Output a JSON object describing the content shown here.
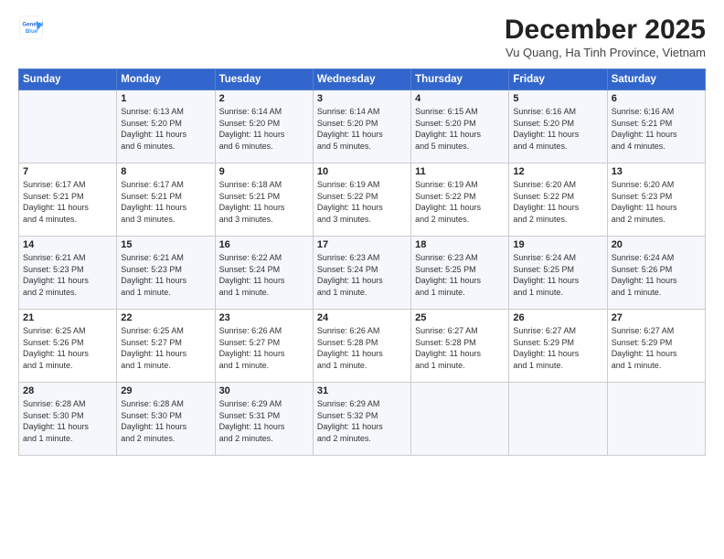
{
  "header": {
    "logo_line1": "General",
    "logo_line2": "Blue",
    "title": "December 2025",
    "subtitle": "Vu Quang, Ha Tinh Province, Vietnam"
  },
  "days_of_week": [
    "Sunday",
    "Monday",
    "Tuesday",
    "Wednesday",
    "Thursday",
    "Friday",
    "Saturday"
  ],
  "weeks": [
    [
      {
        "num": "",
        "info": ""
      },
      {
        "num": "1",
        "info": "Sunrise: 6:13 AM\nSunset: 5:20 PM\nDaylight: 11 hours\nand 6 minutes."
      },
      {
        "num": "2",
        "info": "Sunrise: 6:14 AM\nSunset: 5:20 PM\nDaylight: 11 hours\nand 6 minutes."
      },
      {
        "num": "3",
        "info": "Sunrise: 6:14 AM\nSunset: 5:20 PM\nDaylight: 11 hours\nand 5 minutes."
      },
      {
        "num": "4",
        "info": "Sunrise: 6:15 AM\nSunset: 5:20 PM\nDaylight: 11 hours\nand 5 minutes."
      },
      {
        "num": "5",
        "info": "Sunrise: 6:16 AM\nSunset: 5:20 PM\nDaylight: 11 hours\nand 4 minutes."
      },
      {
        "num": "6",
        "info": "Sunrise: 6:16 AM\nSunset: 5:21 PM\nDaylight: 11 hours\nand 4 minutes."
      }
    ],
    [
      {
        "num": "7",
        "info": "Sunrise: 6:17 AM\nSunset: 5:21 PM\nDaylight: 11 hours\nand 4 minutes."
      },
      {
        "num": "8",
        "info": "Sunrise: 6:17 AM\nSunset: 5:21 PM\nDaylight: 11 hours\nand 3 minutes."
      },
      {
        "num": "9",
        "info": "Sunrise: 6:18 AM\nSunset: 5:21 PM\nDaylight: 11 hours\nand 3 minutes."
      },
      {
        "num": "10",
        "info": "Sunrise: 6:19 AM\nSunset: 5:22 PM\nDaylight: 11 hours\nand 3 minutes."
      },
      {
        "num": "11",
        "info": "Sunrise: 6:19 AM\nSunset: 5:22 PM\nDaylight: 11 hours\nand 2 minutes."
      },
      {
        "num": "12",
        "info": "Sunrise: 6:20 AM\nSunset: 5:22 PM\nDaylight: 11 hours\nand 2 minutes."
      },
      {
        "num": "13",
        "info": "Sunrise: 6:20 AM\nSunset: 5:23 PM\nDaylight: 11 hours\nand 2 minutes."
      }
    ],
    [
      {
        "num": "14",
        "info": "Sunrise: 6:21 AM\nSunset: 5:23 PM\nDaylight: 11 hours\nand 2 minutes."
      },
      {
        "num": "15",
        "info": "Sunrise: 6:21 AM\nSunset: 5:23 PM\nDaylight: 11 hours\nand 1 minute."
      },
      {
        "num": "16",
        "info": "Sunrise: 6:22 AM\nSunset: 5:24 PM\nDaylight: 11 hours\nand 1 minute."
      },
      {
        "num": "17",
        "info": "Sunrise: 6:23 AM\nSunset: 5:24 PM\nDaylight: 11 hours\nand 1 minute."
      },
      {
        "num": "18",
        "info": "Sunrise: 6:23 AM\nSunset: 5:25 PM\nDaylight: 11 hours\nand 1 minute."
      },
      {
        "num": "19",
        "info": "Sunrise: 6:24 AM\nSunset: 5:25 PM\nDaylight: 11 hours\nand 1 minute."
      },
      {
        "num": "20",
        "info": "Sunrise: 6:24 AM\nSunset: 5:26 PM\nDaylight: 11 hours\nand 1 minute."
      }
    ],
    [
      {
        "num": "21",
        "info": "Sunrise: 6:25 AM\nSunset: 5:26 PM\nDaylight: 11 hours\nand 1 minute."
      },
      {
        "num": "22",
        "info": "Sunrise: 6:25 AM\nSunset: 5:27 PM\nDaylight: 11 hours\nand 1 minute."
      },
      {
        "num": "23",
        "info": "Sunrise: 6:26 AM\nSunset: 5:27 PM\nDaylight: 11 hours\nand 1 minute."
      },
      {
        "num": "24",
        "info": "Sunrise: 6:26 AM\nSunset: 5:28 PM\nDaylight: 11 hours\nand 1 minute."
      },
      {
        "num": "25",
        "info": "Sunrise: 6:27 AM\nSunset: 5:28 PM\nDaylight: 11 hours\nand 1 minute."
      },
      {
        "num": "26",
        "info": "Sunrise: 6:27 AM\nSunset: 5:29 PM\nDaylight: 11 hours\nand 1 minute."
      },
      {
        "num": "27",
        "info": "Sunrise: 6:27 AM\nSunset: 5:29 PM\nDaylight: 11 hours\nand 1 minute."
      }
    ],
    [
      {
        "num": "28",
        "info": "Sunrise: 6:28 AM\nSunset: 5:30 PM\nDaylight: 11 hours\nand 1 minute."
      },
      {
        "num": "29",
        "info": "Sunrise: 6:28 AM\nSunset: 5:30 PM\nDaylight: 11 hours\nand 2 minutes."
      },
      {
        "num": "30",
        "info": "Sunrise: 6:29 AM\nSunset: 5:31 PM\nDaylight: 11 hours\nand 2 minutes."
      },
      {
        "num": "31",
        "info": "Sunrise: 6:29 AM\nSunset: 5:32 PM\nDaylight: 11 hours\nand 2 minutes."
      },
      {
        "num": "",
        "info": ""
      },
      {
        "num": "",
        "info": ""
      },
      {
        "num": "",
        "info": ""
      }
    ]
  ]
}
